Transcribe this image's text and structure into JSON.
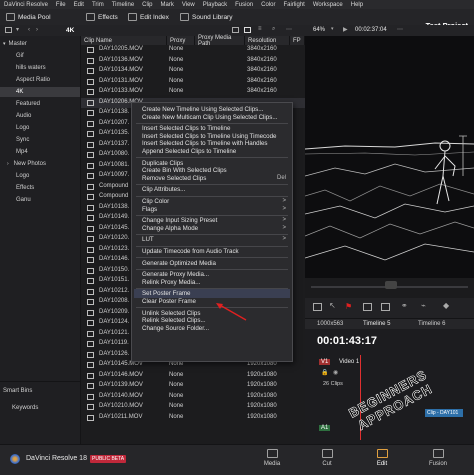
{
  "menubar": [
    "DaVinci Resolve",
    "File",
    "Edit",
    "Trim",
    "Timeline",
    "Clip",
    "Mark",
    "View",
    "Playback",
    "Fusion",
    "Color",
    "Fairlight",
    "Workspace",
    "Help"
  ],
  "toolbar": {
    "media_pool": "Media Pool",
    "effects": "Effects",
    "edit_index": "Edit Index",
    "sound_library": "Sound Library",
    "project_title": "Test Project"
  },
  "pool": {
    "bin_title": "4K"
  },
  "sidebar": {
    "master": "Master",
    "bins": [
      "Gif",
      "hills waters",
      "Aspect Ratio",
      "4K",
      "Featured",
      "Audio",
      "Logo",
      "Sync",
      "Mp4",
      "New Photos",
      "Logo",
      "Effects",
      "Ganu"
    ],
    "smart_bins": "Smart Bins",
    "keywords": "Keywords"
  },
  "table": {
    "headers": [
      "Clip Name",
      "Proxy",
      "Proxy Media Path",
      "Resolution",
      "FP"
    ],
    "rows": [
      {
        "name": "DAY10205.MOV",
        "proxy": "None",
        "res": "3840x2160"
      },
      {
        "name": "DAY10136.MOV",
        "proxy": "None",
        "res": "3840x2160"
      },
      {
        "name": "DAY10134.MOV",
        "proxy": "None",
        "res": "3840x2160"
      },
      {
        "name": "DAY10131.MOV",
        "proxy": "None",
        "res": "3840x2160"
      },
      {
        "name": "DAY10133.MOV",
        "proxy": "None",
        "res": "3840x2160"
      },
      {
        "name": "DAY10206.MOV",
        "proxy": "",
        "res": ""
      },
      {
        "name": "DAY10138.",
        "proxy": "",
        "res": ""
      },
      {
        "name": "DAY10207.",
        "proxy": "",
        "res": ""
      },
      {
        "name": "DAY10135.",
        "proxy": "",
        "res": ""
      },
      {
        "name": "DAY10137.",
        "proxy": "",
        "res": ""
      },
      {
        "name": "DAY10080.",
        "proxy": "",
        "res": ""
      },
      {
        "name": "DAY10081.",
        "proxy": "",
        "res": ""
      },
      {
        "name": "DAY10097.",
        "proxy": "",
        "res": ""
      },
      {
        "name": "Compound",
        "proxy": "",
        "res": ""
      },
      {
        "name": "Compound",
        "proxy": "",
        "res": ""
      },
      {
        "name": "DAY10138.",
        "proxy": "",
        "res": ""
      },
      {
        "name": "DAY10149.",
        "proxy": "",
        "res": ""
      },
      {
        "name": "DAY10145.",
        "proxy": "",
        "res": ""
      },
      {
        "name": "DAY10120.",
        "proxy": "",
        "res": ""
      },
      {
        "name": "DAY10123.",
        "proxy": "",
        "res": ""
      },
      {
        "name": "DAY10146.",
        "proxy": "",
        "res": ""
      },
      {
        "name": "DAY10150.",
        "proxy": "",
        "res": ""
      },
      {
        "name": "DAY10151.",
        "proxy": "",
        "res": ""
      },
      {
        "name": "DAY10212.",
        "proxy": "",
        "res": ""
      },
      {
        "name": "DAY10208.",
        "proxy": "",
        "res": ""
      },
      {
        "name": "DAY10209.",
        "proxy": "",
        "res": ""
      },
      {
        "name": "DAY10124.",
        "proxy": "",
        "res": ""
      },
      {
        "name": "DAY10121.",
        "proxy": "",
        "res": ""
      },
      {
        "name": "DAY10119.",
        "proxy": "",
        "res": ""
      },
      {
        "name": "DAY10126.",
        "proxy": "",
        "res": ""
      },
      {
        "name": "DAY10145.MOV",
        "proxy": "None",
        "res": "1920x1080"
      },
      {
        "name": "DAY10146.MOV",
        "proxy": "None",
        "res": "1920x1080"
      },
      {
        "name": "DAY10139.MOV",
        "proxy": "None",
        "res": "1920x1080"
      },
      {
        "name": "DAY10140.MOV",
        "proxy": "None",
        "res": "1920x1080"
      },
      {
        "name": "DAY10210.MOV",
        "proxy": "None",
        "res": "1920x1080"
      },
      {
        "name": "DAY10211.MOV",
        "proxy": "None",
        "res": "1920x1080"
      }
    ]
  },
  "context_menu": {
    "items": [
      {
        "label": "Create New Timeline Using Selected Clips...",
        "arrow": "",
        "disabled": false
      },
      {
        "label": "Create New Multicam Clip Using Selected Clips...",
        "arrow": "",
        "disabled": false
      },
      {
        "sep": true
      },
      {
        "label": "Insert Selected Clips to Timeline",
        "arrow": "",
        "disabled": false
      },
      {
        "label": "Insert Selected Clips to Timeline Using Timecode",
        "arrow": "",
        "disabled": false
      },
      {
        "label": "Insert Selected Clips to Timeline with Handles",
        "arrow": "",
        "disabled": false
      },
      {
        "label": "Append Selected Clips to Timeline",
        "arrow": "",
        "disabled": false
      },
      {
        "sep": true
      },
      {
        "label": "Duplicate Clips",
        "arrow": "",
        "disabled": false
      },
      {
        "label": "Create Bin With Selected Clips",
        "arrow": "",
        "disabled": false
      },
      {
        "label": "Remove Selected Clips",
        "arrow": "Del",
        "disabled": false
      },
      {
        "sep": true
      },
      {
        "label": "Clip Attributes...",
        "arrow": "",
        "disabled": false
      },
      {
        "sep": true
      },
      {
        "label": "Clip Color",
        "arrow": ">",
        "disabled": false
      },
      {
        "label": "Flags",
        "arrow": ">",
        "disabled": false
      },
      {
        "sep": true
      },
      {
        "label": "Change Input Sizing Preset",
        "arrow": ">",
        "disabled": false
      },
      {
        "label": "Change Alpha Mode",
        "arrow": ">",
        "disabled": false
      },
      {
        "sep": true
      },
      {
        "label": "LUT",
        "arrow": ">",
        "disabled": false
      },
      {
        "sep": true
      },
      {
        "label": "Update Timecode from Audio Track",
        "arrow": "",
        "disabled": false
      },
      {
        "sep": true
      },
      {
        "label": "Generate Optimized Media",
        "arrow": "",
        "disabled": false
      },
      {
        "sep": true
      },
      {
        "label": "Generate Proxy Media...",
        "arrow": "",
        "disabled": false
      },
      {
        "label": "Relink Proxy Media...",
        "arrow": "",
        "disabled": false
      },
      {
        "sep": true
      },
      {
        "label": "Set Poster Frame",
        "arrow": "",
        "disabled": false
      },
      {
        "label": "Clear Poster Frame",
        "arrow": "",
        "disabled": false
      },
      {
        "sep": true
      },
      {
        "label": "Unlink Selected Clips",
        "arrow": "",
        "disabled": false
      },
      {
        "label": "Relink Selected Clips...",
        "arrow": "",
        "disabled": false
      },
      {
        "label": "Change Source Folder...",
        "arrow": "",
        "disabled": false
      }
    ]
  },
  "viewer": {
    "zoom": "64%",
    "timecode": "00:02:37:04"
  },
  "timeline": {
    "resolution": "1000x563",
    "tab_timeline5": "Timeline 5",
    "tab_timeline6": "Timeline 6",
    "timecode": "00:01:43:17",
    "video_track": "Video 1",
    "video_label": "V1",
    "clip_count": "26 Clips",
    "audio_label": "A1",
    "clip_name": "Clip - DAY101"
  },
  "watermark": "BEGINNERS APPROACH",
  "bottombar": {
    "app_name": "DaVinci Resolve 18",
    "badge": "PUBLIC BETA",
    "tabs": [
      "Media",
      "Cut",
      "Edit",
      "Fusion"
    ]
  },
  "colors": {
    "accent": "#e0a040",
    "badge": "#c0283a",
    "selection": "#3a3f52",
    "arrow": "#e02020"
  }
}
